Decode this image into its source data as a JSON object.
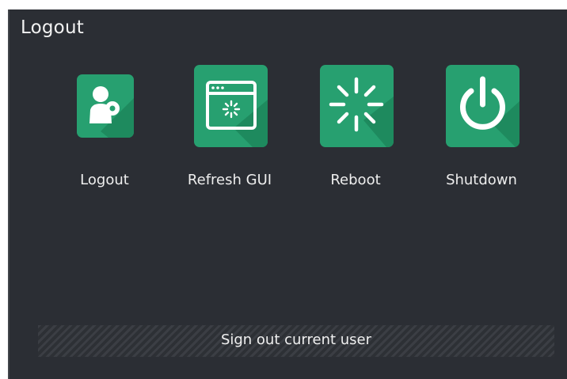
{
  "window": {
    "title": "Logout"
  },
  "actions": [
    {
      "label": "Logout",
      "icon": "user-key-icon"
    },
    {
      "label": "Refresh GUI",
      "icon": "refresh-window-icon"
    },
    {
      "label": "Reboot",
      "icon": "spinner-icon"
    },
    {
      "label": "Shutdown",
      "icon": "power-icon"
    }
  ],
  "status": {
    "text": "Sign out current user"
  },
  "colors": {
    "background": "#2b2e34",
    "tile": "#27a070",
    "tile_shadow": "#1e8a5e",
    "text": "#f2f2f2"
  }
}
